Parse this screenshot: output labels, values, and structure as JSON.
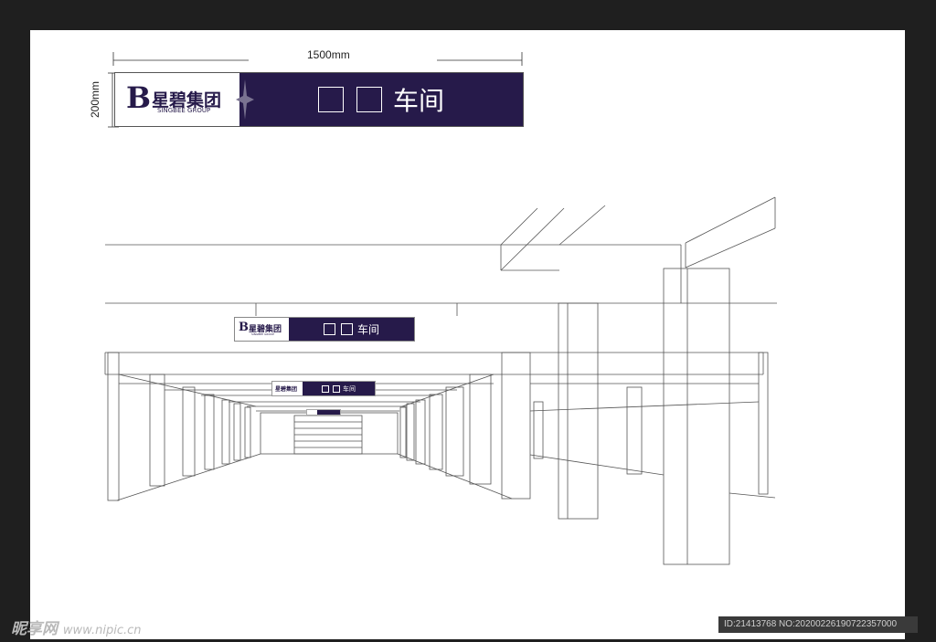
{
  "dimensions": {
    "width_label": "1500mm",
    "height_label": "200mm"
  },
  "brand": {
    "cn_name": "星碧集团",
    "en_name": "SINGBEE GROUP",
    "mark": "B"
  },
  "sign": {
    "text": "车间",
    "placeholder_boxes": 2
  },
  "colors": {
    "sign_dark": "#261a4a",
    "background": "#1f1f1f",
    "sheet": "#ffffff"
  },
  "watermark": {
    "site": "昵享网",
    "url": "www.nipic.cn",
    "id_text": "ID:21413768 NO:20200226190722357000"
  }
}
